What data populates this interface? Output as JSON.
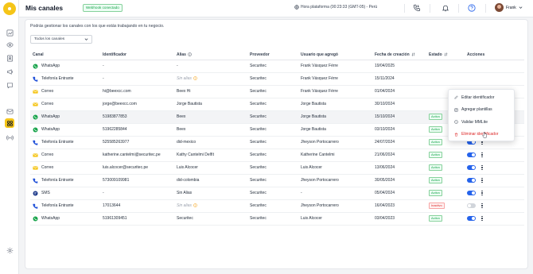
{
  "header": {
    "title": "Mis canales",
    "webhook_badge": "Webhook conectado",
    "clock": "Hora plataforma (00:23:33 (GMT-05) - Perú",
    "user_name": "Frank"
  },
  "sidebar": {
    "items": [
      {
        "icon": "chart-icon"
      },
      {
        "icon": "eye-icon"
      },
      {
        "icon": "contact-card-icon"
      },
      {
        "icon": "megaphone-icon"
      },
      {
        "icon": "chat-icon"
      },
      {
        "icon": "inbox-icon"
      },
      {
        "icon": "channels-icon"
      },
      {
        "icon": "broadcast-icon"
      },
      {
        "icon": "settings-icon"
      }
    ]
  },
  "main": {
    "description": "Podrás gestionar los canales con los que estás trabajando en tu negocio.",
    "filter": {
      "value": "Todos los canales"
    },
    "columns": [
      "Canal",
      "Identificador",
      "Alias",
      "Proveedor",
      "Usuario que agregó",
      "Fecha de creación",
      "Estado",
      "Acciones"
    ],
    "rows": [
      {
        "canal": "WhatsApp",
        "icon": "whatsapp-icon",
        "identificador": "-",
        "alias": "-",
        "alias_muted": false,
        "alias_warn": false,
        "proveedor": "Securitec",
        "usuario": "Frank Vásquez Férre",
        "fecha": "19/04/2025",
        "estado": "",
        "toggle": "none"
      },
      {
        "canal": "Telefonía Entrante",
        "icon": "phone-icon",
        "identificador": "-",
        "alias": "Sin alias",
        "alias_muted": true,
        "alias_warn": true,
        "proveedor": "Securitec",
        "usuario": "Frank Vásquez Férre",
        "fecha": "15/11/2024",
        "estado": "",
        "toggle": "none"
      },
      {
        "canal": "Correo",
        "icon": "mail-icon",
        "identificador": "hi@beexcc.com",
        "alias": "Beex Hi",
        "alias_muted": false,
        "alias_warn": false,
        "proveedor": "Securitec",
        "usuario": "Frank Vásquez Férre",
        "fecha": "01/04/2024",
        "estado": "",
        "toggle": "none"
      },
      {
        "canal": "Correo",
        "icon": "mail-icon",
        "identificador": "jorge@beexcc.com",
        "alias": "Jorge Bautista",
        "alias_muted": false,
        "alias_warn": false,
        "proveedor": "Securitec",
        "usuario": "Jorge Bautista",
        "fecha": "30/10/2024",
        "estado": "",
        "toggle": "none"
      },
      {
        "canal": "WhatsApp",
        "icon": "whatsapp-icon",
        "identificador": "51983877853",
        "alias": "Beex",
        "alias_muted": false,
        "alias_warn": false,
        "proveedor": "Securitec",
        "usuario": "Jorge Bautista",
        "fecha": "15/10/2024",
        "estado": "Activo",
        "toggle": "on"
      },
      {
        "canal": "WhatsApp",
        "icon": "whatsapp-icon",
        "identificador": "51962285844",
        "alias": "Beex",
        "alias_muted": false,
        "alias_warn": false,
        "proveedor": "Securitec",
        "usuario": "Jorge Bautista",
        "fecha": "03/10/2024",
        "estado": "Activo",
        "toggle": "on"
      },
      {
        "canal": "Telefonía Entrante",
        "icon": "phone-icon",
        "identificador": "525585263977",
        "alias": "did-mexico",
        "alias_muted": false,
        "alias_warn": false,
        "proveedor": "Securitec",
        "usuario": "Jheyson Portocarrero",
        "fecha": "24/07/2024",
        "estado": "Activo",
        "toggle": "on"
      },
      {
        "canal": "Correo",
        "icon": "mail-icon",
        "identificador": "katherine.cantelmi@securitec.pe",
        "alias": "Kathy Cantelmi Delfít",
        "alias_muted": false,
        "alias_warn": false,
        "proveedor": "Securitec",
        "usuario": "Katherine Cantelmi",
        "fecha": "21/06/2024",
        "estado": "Activo",
        "toggle": "on"
      },
      {
        "canal": "Correo",
        "icon": "mail-icon",
        "identificador": "luis.alcocer@securitec.pe",
        "alias": "Luis Alcocer",
        "alias_muted": false,
        "alias_warn": false,
        "proveedor": "Securitec",
        "usuario": "Luis Alcocer",
        "fecha": "13/06/2024",
        "estado": "Activo",
        "toggle": "on"
      },
      {
        "canal": "Telefonía Entrante",
        "icon": "phone-icon",
        "identificador": "573009109981",
        "alias": "did-colombia",
        "alias_muted": false,
        "alias_warn": false,
        "proveedor": "Securitec",
        "usuario": "Jheyson Portocarrero",
        "fecha": "30/05/2024",
        "estado": "Activo",
        "toggle": "on"
      },
      {
        "canal": "SMS",
        "icon": "sms-icon",
        "identificador": "-",
        "alias": "Sin Alias",
        "alias_muted": false,
        "alias_warn": false,
        "proveedor": "Securitec",
        "usuario": "-",
        "fecha": "05/04/2024",
        "estado": "Activo",
        "toggle": "on"
      },
      {
        "canal": "Telefonía Entrante",
        "icon": "phone-icon",
        "identificador": "17013644",
        "alias": "Sin alias",
        "alias_muted": true,
        "alias_warn": true,
        "proveedor": "Securitec",
        "usuario": "Jheyson Portocarrero",
        "fecha": "16/04/2023",
        "estado": "Inactivo",
        "toggle": "off"
      },
      {
        "canal": "WhatsApp",
        "icon": "whatsapp-icon",
        "identificador": "51961309451",
        "alias": "Securitec",
        "alias_muted": false,
        "alias_warn": false,
        "proveedor": "Securitec",
        "usuario": "Luis Alcocer",
        "fecha": "03/04/2023",
        "estado": "Activo",
        "toggle": "on"
      }
    ]
  },
  "menu": {
    "items": [
      {
        "label": "Editar identificador",
        "icon": "pencil-icon",
        "danger": false
      },
      {
        "label": "Agregar plantillas",
        "icon": "template-icon",
        "danger": false
      },
      {
        "label": "Validar MMLite",
        "icon": "whatsapp-icon",
        "danger": false
      },
      {
        "label": "Eliminar identificador",
        "icon": "trash-icon",
        "danger": true
      }
    ]
  },
  "colors": {
    "brand": "#f5c518",
    "whatsapp": "#16a34a",
    "phone": "#1d4ed8",
    "mail": "#f5c518",
    "sms": "#1e3a8a",
    "toggle_on": "#2563eb",
    "danger": "#dc2626"
  }
}
